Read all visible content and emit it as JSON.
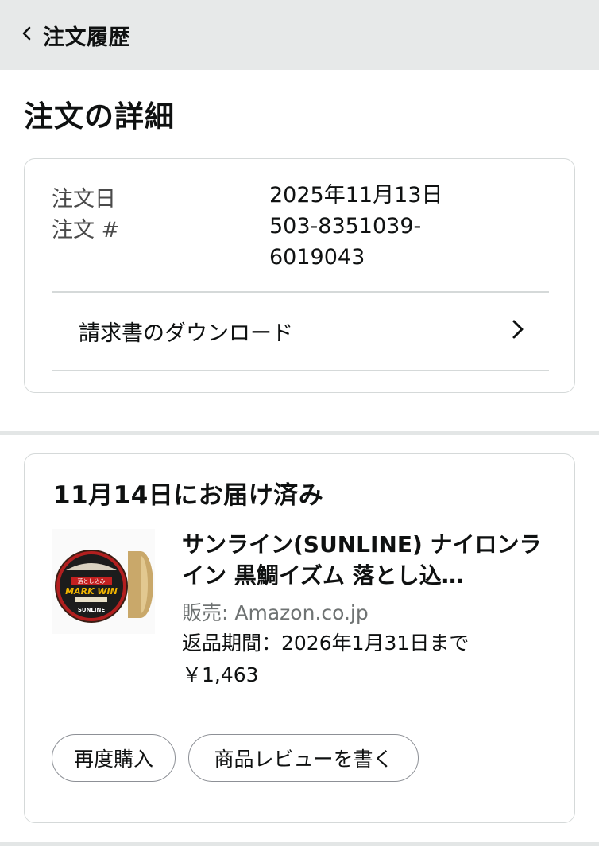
{
  "header": {
    "back_label": "注文履歴"
  },
  "page": {
    "title": "注文の詳細"
  },
  "order": {
    "date_label": "注文日",
    "date_value": "2025年11月13日",
    "number_label": "注文 #",
    "number_value": "503-8351039-6019043",
    "invoice_label": "請求書のダウンロード"
  },
  "shipment": {
    "status": "11月14日にお届け済み",
    "product": {
      "title": "サンライン(SUNLINE) ナイロンライン 黒鯛イズム 落とし込…",
      "seller": "販売: Amazon.co.jp",
      "return_period": "返品期間：2026年1月31日まで",
      "price": "￥1,463",
      "image_text": {
        "brand": "SUNLINE",
        "name": "MARK WIN",
        "jp": "落とし込み"
      }
    },
    "buttons": {
      "rebuy": "再度購入",
      "review": "商品レビューを書く"
    }
  },
  "icons": {
    "back": "chevron-left-icon",
    "invoice": "chevron-right-icon"
  }
}
